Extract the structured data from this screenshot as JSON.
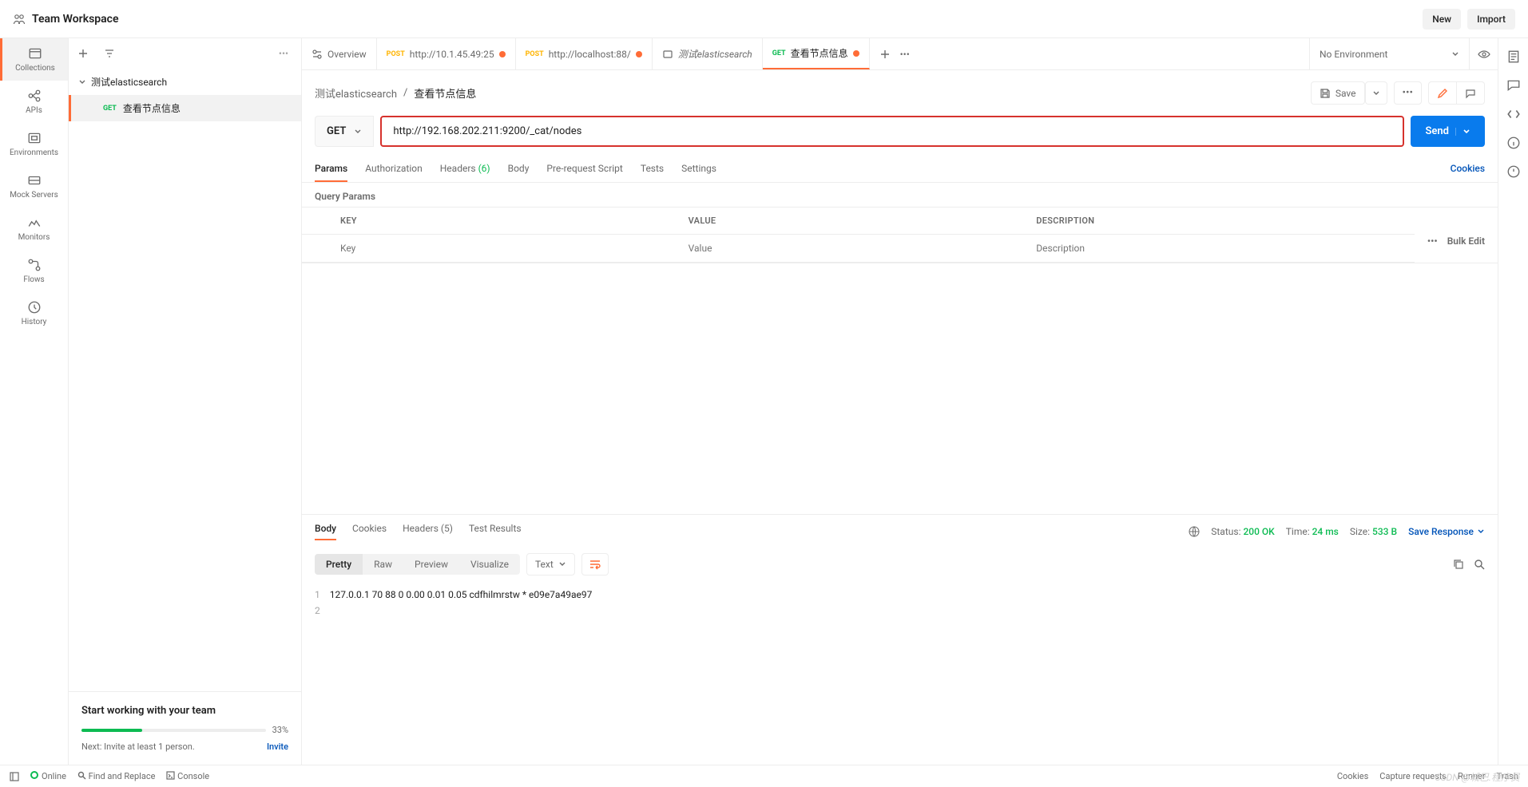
{
  "header": {
    "workspace": "Team Workspace",
    "new": "New",
    "import": "Import"
  },
  "rail": {
    "collections": "Collections",
    "apis": "APIs",
    "environments": "Environments",
    "mock": "Mock Servers",
    "monitors": "Monitors",
    "flows": "Flows",
    "history": "History"
  },
  "tree": {
    "collection": "测试elasticsearch",
    "req1_method": "GET",
    "req1_name": "查看节点信息"
  },
  "hint": {
    "title": "Start working with your team",
    "pct": "33%",
    "next": "Next: Invite at least 1 person.",
    "invite": "Invite"
  },
  "tabs": {
    "overview": "Overview",
    "t1_method": "POST",
    "t1_url": "http://10.1.45.49:25",
    "t2_method": "POST",
    "t2_url": "http://localhost:88/",
    "t3_name": "测试elasticsearch",
    "t4_method": "GET",
    "t4_name": "查看节点信息",
    "env": "No Environment"
  },
  "crumb": {
    "parent": "测试elasticsearch",
    "sep": "/",
    "current": "查看节点信息",
    "save": "Save"
  },
  "request": {
    "method": "GET",
    "url": "http://192.168.202.211:9200/_cat/nodes",
    "send": "Send"
  },
  "reqtabs": {
    "params": "Params",
    "auth": "Authorization",
    "headers": "Headers",
    "headers_count": "(6)",
    "body": "Body",
    "prereq": "Pre-request Script",
    "tests": "Tests",
    "settings": "Settings",
    "cookies": "Cookies"
  },
  "qp": {
    "title": "Query Params",
    "key": "KEY",
    "value": "VALUE",
    "desc": "DESCRIPTION",
    "ph_key": "Key",
    "ph_value": "Value",
    "ph_desc": "Description",
    "more": "•••",
    "bulk": "Bulk Edit"
  },
  "res": {
    "body": "Body",
    "cookies": "Cookies",
    "headers": "Headers",
    "headers_count": "(5)",
    "test": "Test Results",
    "status_label": "Status:",
    "status_val": "200 OK",
    "time_label": "Time:",
    "time_val": "24 ms",
    "size_label": "Size:",
    "size_val": "533 B",
    "save": "Save Response",
    "pretty": "Pretty",
    "raw": "Raw",
    "preview": "Preview",
    "visualize": "Visualize",
    "fmt": "Text",
    "line1": "127.0.0.1 70 88 0 0.00 0.01 0.05 cdfhilmrstw * e09e7a49ae97",
    "ln1": "1",
    "ln2": "2"
  },
  "footer": {
    "online": "Online",
    "find": "Find and Replace",
    "console": "Console",
    "cookies": "Cookies",
    "capture": "Capture requests",
    "runner": "Runner",
    "trash": "Trash"
  },
  "watermark": "CSDN @城巴.程序员"
}
